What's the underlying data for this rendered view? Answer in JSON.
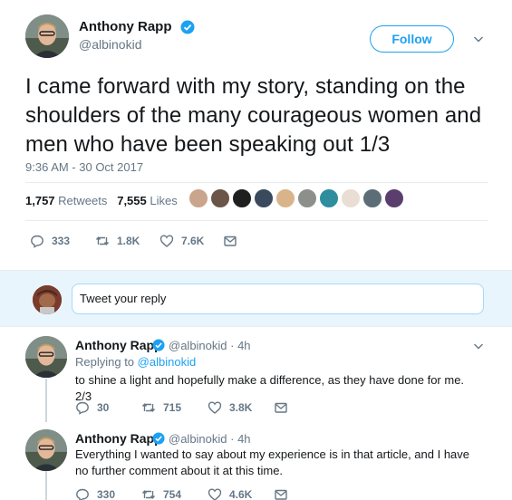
{
  "main_tweet": {
    "author_name": "Anthony Rapp",
    "handle": "@albinokid",
    "follow_label": "Follow",
    "text": "I came forward with my story, standing on the shoulders of the many courageous women and men who have been speaking out 1/3",
    "timestamp": "9:36 AM - 30 Oct 2017",
    "retweets_count": "1,757",
    "retweets_label": "Retweets",
    "likes_count": "7,555",
    "likes_label": "Likes",
    "actions": {
      "replies": "333",
      "retweets": "1.8K",
      "likes": "7.6K"
    }
  },
  "reply_box": {
    "placeholder": "Tweet your reply"
  },
  "replies": [
    {
      "author_name": "Anthony Rapp",
      "handle_time": "@albinokid · 4h",
      "replying_prefix": "Replying to",
      "replying_to": "@albinokid",
      "text": "to shine a light and hopefully make a difference, as they have done for me.  2/3",
      "actions": {
        "replies": "30",
        "retweets": "715",
        "likes": "3.8K"
      }
    },
    {
      "author_name": "Anthony Rapp",
      "handle_time": "@albinokid · 4h",
      "text": "Everything I wanted to say about my experience is in that article, and I have no further comment about it at this time.",
      "actions": {
        "replies": "330",
        "retweets": "754",
        "likes": "4.6K"
      }
    }
  ],
  "colors": {
    "accent": "#1da1f2",
    "muted": "#657786",
    "text": "#14171a",
    "reply_bar_bg": "#e8f5fd"
  }
}
